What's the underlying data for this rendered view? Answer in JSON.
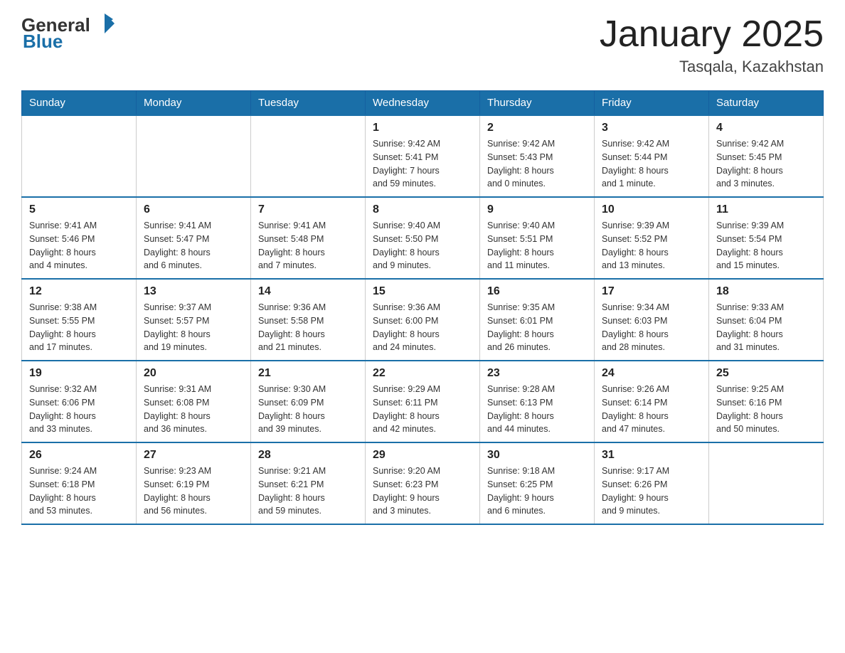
{
  "header": {
    "logo": {
      "general": "General",
      "flag_shape": "▶",
      "blue": "Blue"
    },
    "title": "January 2025",
    "location": "Tasqala, Kazakhstan"
  },
  "weekdays": [
    "Sunday",
    "Monday",
    "Tuesday",
    "Wednesday",
    "Thursday",
    "Friday",
    "Saturday"
  ],
  "weeks": [
    [
      {
        "day": "",
        "info": ""
      },
      {
        "day": "",
        "info": ""
      },
      {
        "day": "",
        "info": ""
      },
      {
        "day": "1",
        "info": "Sunrise: 9:42 AM\nSunset: 5:41 PM\nDaylight: 7 hours\nand 59 minutes."
      },
      {
        "day": "2",
        "info": "Sunrise: 9:42 AM\nSunset: 5:43 PM\nDaylight: 8 hours\nand 0 minutes."
      },
      {
        "day": "3",
        "info": "Sunrise: 9:42 AM\nSunset: 5:44 PM\nDaylight: 8 hours\nand 1 minute."
      },
      {
        "day": "4",
        "info": "Sunrise: 9:42 AM\nSunset: 5:45 PM\nDaylight: 8 hours\nand 3 minutes."
      }
    ],
    [
      {
        "day": "5",
        "info": "Sunrise: 9:41 AM\nSunset: 5:46 PM\nDaylight: 8 hours\nand 4 minutes."
      },
      {
        "day": "6",
        "info": "Sunrise: 9:41 AM\nSunset: 5:47 PM\nDaylight: 8 hours\nand 6 minutes."
      },
      {
        "day": "7",
        "info": "Sunrise: 9:41 AM\nSunset: 5:48 PM\nDaylight: 8 hours\nand 7 minutes."
      },
      {
        "day": "8",
        "info": "Sunrise: 9:40 AM\nSunset: 5:50 PM\nDaylight: 8 hours\nand 9 minutes."
      },
      {
        "day": "9",
        "info": "Sunrise: 9:40 AM\nSunset: 5:51 PM\nDaylight: 8 hours\nand 11 minutes."
      },
      {
        "day": "10",
        "info": "Sunrise: 9:39 AM\nSunset: 5:52 PM\nDaylight: 8 hours\nand 13 minutes."
      },
      {
        "day": "11",
        "info": "Sunrise: 9:39 AM\nSunset: 5:54 PM\nDaylight: 8 hours\nand 15 minutes."
      }
    ],
    [
      {
        "day": "12",
        "info": "Sunrise: 9:38 AM\nSunset: 5:55 PM\nDaylight: 8 hours\nand 17 minutes."
      },
      {
        "day": "13",
        "info": "Sunrise: 9:37 AM\nSunset: 5:57 PM\nDaylight: 8 hours\nand 19 minutes."
      },
      {
        "day": "14",
        "info": "Sunrise: 9:36 AM\nSunset: 5:58 PM\nDaylight: 8 hours\nand 21 minutes."
      },
      {
        "day": "15",
        "info": "Sunrise: 9:36 AM\nSunset: 6:00 PM\nDaylight: 8 hours\nand 24 minutes."
      },
      {
        "day": "16",
        "info": "Sunrise: 9:35 AM\nSunset: 6:01 PM\nDaylight: 8 hours\nand 26 minutes."
      },
      {
        "day": "17",
        "info": "Sunrise: 9:34 AM\nSunset: 6:03 PM\nDaylight: 8 hours\nand 28 minutes."
      },
      {
        "day": "18",
        "info": "Sunrise: 9:33 AM\nSunset: 6:04 PM\nDaylight: 8 hours\nand 31 minutes."
      }
    ],
    [
      {
        "day": "19",
        "info": "Sunrise: 9:32 AM\nSunset: 6:06 PM\nDaylight: 8 hours\nand 33 minutes."
      },
      {
        "day": "20",
        "info": "Sunrise: 9:31 AM\nSunset: 6:08 PM\nDaylight: 8 hours\nand 36 minutes."
      },
      {
        "day": "21",
        "info": "Sunrise: 9:30 AM\nSunset: 6:09 PM\nDaylight: 8 hours\nand 39 minutes."
      },
      {
        "day": "22",
        "info": "Sunrise: 9:29 AM\nSunset: 6:11 PM\nDaylight: 8 hours\nand 42 minutes."
      },
      {
        "day": "23",
        "info": "Sunrise: 9:28 AM\nSunset: 6:13 PM\nDaylight: 8 hours\nand 44 minutes."
      },
      {
        "day": "24",
        "info": "Sunrise: 9:26 AM\nSunset: 6:14 PM\nDaylight: 8 hours\nand 47 minutes."
      },
      {
        "day": "25",
        "info": "Sunrise: 9:25 AM\nSunset: 6:16 PM\nDaylight: 8 hours\nand 50 minutes."
      }
    ],
    [
      {
        "day": "26",
        "info": "Sunrise: 9:24 AM\nSunset: 6:18 PM\nDaylight: 8 hours\nand 53 minutes."
      },
      {
        "day": "27",
        "info": "Sunrise: 9:23 AM\nSunset: 6:19 PM\nDaylight: 8 hours\nand 56 minutes."
      },
      {
        "day": "28",
        "info": "Sunrise: 9:21 AM\nSunset: 6:21 PM\nDaylight: 8 hours\nand 59 minutes."
      },
      {
        "day": "29",
        "info": "Sunrise: 9:20 AM\nSunset: 6:23 PM\nDaylight: 9 hours\nand 3 minutes."
      },
      {
        "day": "30",
        "info": "Sunrise: 9:18 AM\nSunset: 6:25 PM\nDaylight: 9 hours\nand 6 minutes."
      },
      {
        "day": "31",
        "info": "Sunrise: 9:17 AM\nSunset: 6:26 PM\nDaylight: 9 hours\nand 9 minutes."
      },
      {
        "day": "",
        "info": ""
      }
    ]
  ]
}
